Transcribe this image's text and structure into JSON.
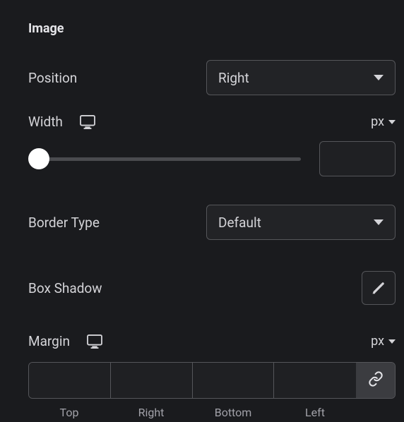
{
  "section": {
    "title": "Image"
  },
  "position": {
    "label": "Position",
    "value": "Right"
  },
  "width": {
    "label": "Width",
    "unit": "px",
    "value": ""
  },
  "borderType": {
    "label": "Border Type",
    "value": "Default"
  },
  "boxShadow": {
    "label": "Box Shadow"
  },
  "margin": {
    "label": "Margin",
    "unit": "px",
    "sides": {
      "top": {
        "label": "Top",
        "value": ""
      },
      "right": {
        "label": "Right",
        "value": ""
      },
      "bottom": {
        "label": "Bottom",
        "value": ""
      },
      "left": {
        "label": "Left",
        "value": ""
      }
    }
  }
}
